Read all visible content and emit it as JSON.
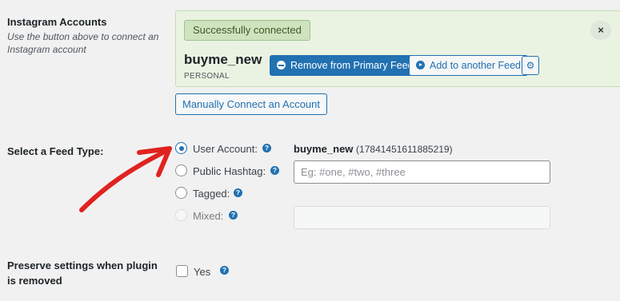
{
  "accounts_row": {
    "label": "Instagram Accounts",
    "description": "Use the button above to connect an Instagram account",
    "success_text": "Successfully connected",
    "close_icon": "×",
    "account": {
      "username": "buyme_new",
      "type": "PERSONAL"
    },
    "remove_button": "Remove from Primary Feed",
    "add_button": "Add to another Feed",
    "settings_icon": "gear-icon",
    "manual_connect_button": "Manually Connect an Account"
  },
  "feed_type_row": {
    "label": "Select a Feed Type:",
    "options": [
      {
        "label": "User Account:",
        "selected": true,
        "disabled": false
      },
      {
        "label": "Public Hashtag:",
        "selected": false,
        "disabled": false
      },
      {
        "label": "Tagged:",
        "selected": false,
        "disabled": false
      },
      {
        "label": "Mixed:",
        "selected": false,
        "disabled": true
      }
    ],
    "user_account_value": {
      "username": "buyme_new",
      "id": "(17841451611885219)"
    },
    "hashtag_placeholder": "Eg: #one, #two, #three",
    "help_glyph": "?"
  },
  "preserve_row": {
    "label": "Preserve settings when plugin is removed",
    "checkbox_label": "Yes",
    "checked": false
  },
  "colors": {
    "accent": "#2271b1",
    "success_bg": "#eaf3e2",
    "annotation_arrow": "#e0231f"
  }
}
